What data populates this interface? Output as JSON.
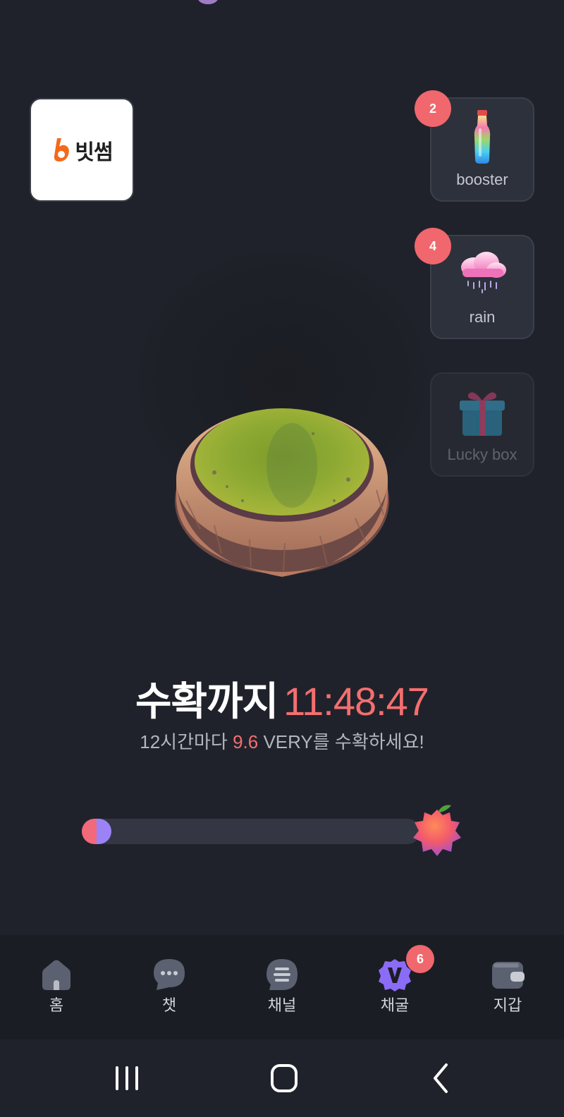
{
  "sponsor": {
    "logo_text": "빗썸"
  },
  "items": [
    {
      "label": "booster",
      "count": "2",
      "icon": "booster-bottle-icon",
      "enabled": true
    },
    {
      "label": "rain",
      "count": "4",
      "icon": "rain-cloud-icon",
      "enabled": true
    },
    {
      "label": "Lucky box",
      "count": "",
      "icon": "gift-box-icon",
      "enabled": false
    }
  ],
  "harvest": {
    "label": "수확까지",
    "time": "11:48:47",
    "sub_prefix": "12시간마다 ",
    "amount": "9.6",
    "sub_suffix": " VERY를 수확하세요!"
  },
  "progress": {
    "fraction": 0.02
  },
  "nav": [
    {
      "label": "홈",
      "icon": "home-icon"
    },
    {
      "label": "챗",
      "icon": "chat-icon"
    },
    {
      "label": "채널",
      "icon": "channel-icon"
    },
    {
      "label": "채굴",
      "icon": "mining-v-icon",
      "badge": "6"
    },
    {
      "label": "지갑",
      "icon": "wallet-icon"
    }
  ],
  "colors": {
    "background": "#20222b",
    "accent_red": "#f36f6f",
    "accent_purple": "#8b6cf6",
    "badge": "#f0676d"
  }
}
